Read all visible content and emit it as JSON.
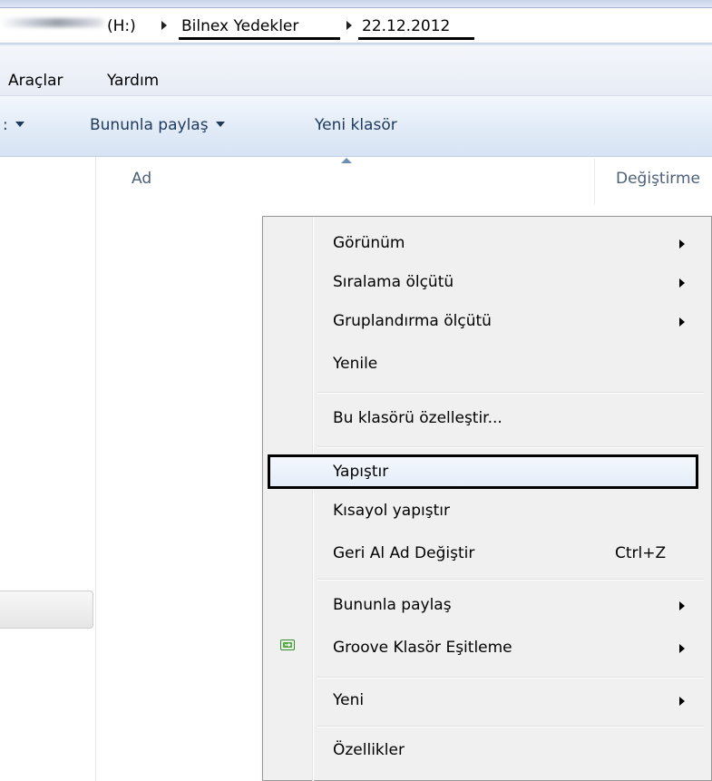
{
  "address": {
    "drive": "(H:)",
    "crumbs": [
      "Bilnex Yedekler",
      "22.12.2012"
    ]
  },
  "menubar": {
    "items": [
      "Araçlar",
      "Yardım"
    ]
  },
  "commandbar": {
    "share": "Bununla paylaş",
    "new_folder": "Yeni klasör"
  },
  "columns": {
    "name": "Ad",
    "modified": "Değiştirme"
  },
  "context_menu": {
    "items": [
      {
        "label": "Görünüm",
        "submenu": true
      },
      {
        "label": "Sıralama ölçütü",
        "submenu": true
      },
      {
        "label": "Gruplandırma ölçütü",
        "submenu": true
      },
      {
        "label": "Yenile",
        "submenu": false
      },
      {
        "label": "Bu klasörü özelleştir...",
        "submenu": false
      },
      {
        "label": "Yapıştır",
        "submenu": false,
        "highlighted": true
      },
      {
        "label": "Kısayol yapıştır",
        "submenu": false
      },
      {
        "label": "Geri Al Ad Değiştir",
        "submenu": false,
        "shortcut": "Ctrl+Z"
      },
      {
        "label": "Bununla paylaş",
        "submenu": true
      },
      {
        "label": "Groove Klasör Eşitleme",
        "submenu": true,
        "icon": "groove-folder-sync-icon"
      },
      {
        "label": "Yeni",
        "submenu": true
      },
      {
        "label": "Özellikler",
        "submenu": false
      }
    ]
  },
  "colors": {
    "highlight_border": "#000000",
    "menu_background": "#f0f0f0",
    "command_text": "#1e395b",
    "groove_icon": "#3a8a3a"
  }
}
